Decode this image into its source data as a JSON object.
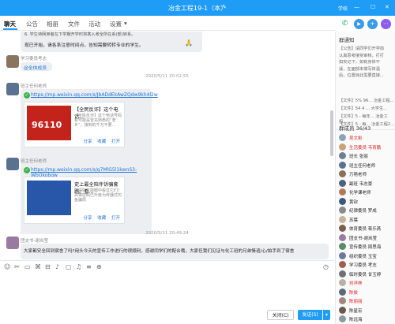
{
  "window": {
    "title": "冶金工程19-1（本）",
    "edit_glyph": "✎",
    "user_label": "学校",
    "minimize": "—",
    "maximize": "☐",
    "close": "✕"
  },
  "tabs": [
    {
      "label": "聊天"
    },
    {
      "label": "公告"
    },
    {
      "label": "相册"
    },
    {
      "label": "文件"
    },
    {
      "label": "活动"
    },
    {
      "label": "设置"
    }
  ],
  "tab_extra": "▾",
  "toolbar": {
    "phone": "✆",
    "video": "▶",
    "add": "+",
    "more": "⋯"
  },
  "messages": [
    {
      "lines": [
        "6. 学生待网单者在下学期开学时将携入考全所在系(部)转系。",
        "现已开始，请各系注意时间点，告知需要转转专业的学生。"
      ],
      "emoji": "🙏"
    },
    {
      "sender": "学习委员考志",
      "text": "@全体成员"
    },
    {
      "time": "2020/5/11 20:02:55",
      "sender": "班主任何老师",
      "link": "https://mp.weixin.qq.com/s/JbADdEkAwZQdw9kh4l2w",
      "card_title": "【全民反诈】这个电话...",
      "card_desc": "【全民反诈】这个电话号码有可能是冒充熟悉的“老乡”，接到的千万不要...",
      "thumb_text": "96110",
      "actions": [
        "分享",
        "收藏",
        "打开"
      ]
    },
    {
      "sender": "班主任何老师",
      "link": "https://mp.weixin.qq.com/s/g7MlG5l1kwnS3-WbOkobgw",
      "card_title": "史上最全陪伴诉骗套路。看...",
      "card_desc": "骗得好友能眼中看过它们！高等密码已升级为传播式钓鱼骗局",
      "actions": [
        "分享",
        "收藏",
        "打开"
      ]
    },
    {
      "time": "2020/5/11 20:49:24",
      "sender": "团支书-谢岚莹",
      "text": "大家都安全回到宿舍了吗?用头今天的宣传工作进行的很顺利，感谢同学们的配合哦，大家任我们见证与化工班的兄弟情谊/心/拍手到了宿舍"
    }
  ],
  "input_toolbar": [
    "☺",
    "✂",
    "▭",
    "⌘",
    "⊟",
    "♪",
    "▢",
    "♫",
    "≡",
    "⊕",
    "◷"
  ],
  "input_buttons": {
    "close": "关闭(C)",
    "send": "发送(S)",
    "send_dropdown": "▾"
  },
  "sidebar": {
    "notice_title": "群通知",
    "notice_lines": [
      "【公告】请同学们开学前",
      "认真思考接受审核，打打",
      "",
      "如实记下，如有身体不",
      "适，在面部未填写体温",
      "后，位置目此需要直接..."
    ],
    "files": [
      "【文件】5%",
      "【文件】54 4 ...",
      "【文件】5 - 每年...",
      "【文件】5 - 每..."
    ],
    "file_titles": [
      "96... 冶金工程...",
      "大学生...",
      "冶金工程...",
      "冶金工程2..."
    ],
    "members_title": "群成员 36/43",
    "members": [
      {
        "name": "吴文彬",
        "color": "#e02020",
        "av": "#8fa3b8"
      },
      {
        "name": "生活委员 韦育鹏",
        "color": "#e02020",
        "av": "#c9a27a"
      },
      {
        "name": "班长 张丽",
        "color": "#222",
        "av": "#6e7f94"
      },
      {
        "name": "班主任何老师",
        "color": "#222",
        "av": "#5a7290"
      },
      {
        "name": "万艳老师",
        "color": "#222",
        "av": "#8a6f5a"
      },
      {
        "name": "副班 韦志豪",
        "color": "#222",
        "av": "#4c6478"
      },
      {
        "name": "化学课老师",
        "color": "#222",
        "av": "#b07a5c"
      },
      {
        "name": "黄钦",
        "color": "#222",
        "av": "#3a5a7a"
      },
      {
        "name": "纪律委员 罗成",
        "color": "#222",
        "av": "#8a8a8a"
      },
      {
        "name": "苏葉",
        "color": "#222",
        "av": "#c5b49a"
      },
      {
        "name": "体育委员 蒋乐燕",
        "color": "#222",
        "av": "#7a6050"
      },
      {
        "name": "团支书-谢岚莹",
        "color": "#222",
        "av": "#9a7aa0"
      },
      {
        "name": "宣传委员 周思海",
        "color": "#222",
        "av": "#5a8a6a"
      },
      {
        "name": "组织委员 玉宝",
        "color": "#222",
        "av": "#6a7a9a"
      },
      {
        "name": "学习委员 考志",
        "color": "#222",
        "av": "#a06050"
      },
      {
        "name": "临时委员 甘玉婷",
        "color": "#222",
        "av": "#707070"
      },
      {
        "name": "刘洋林",
        "color": "#e02020",
        "av": "#b8b0a0"
      },
      {
        "name": "陈俊",
        "color": "#e02020",
        "av": "#5a6a7a"
      },
      {
        "name": "陈丽丽",
        "color": "#e02020",
        "av": "#a0887a"
      },
      {
        "name": "陈星宏",
        "color": "#222",
        "av": "#6a5a4a"
      },
      {
        "name": "陈远海",
        "color": "#222",
        "av": "#8a9aa0"
      },
      {
        "name": "陈金正学长",
        "color": "#222",
        "av": "#4a5a6a"
      }
    ]
  },
  "colors": {
    "accent": "#1e9cf6",
    "link": "#1a73d9",
    "verified": "#3bb54a",
    "red_name": "#e02020"
  }
}
